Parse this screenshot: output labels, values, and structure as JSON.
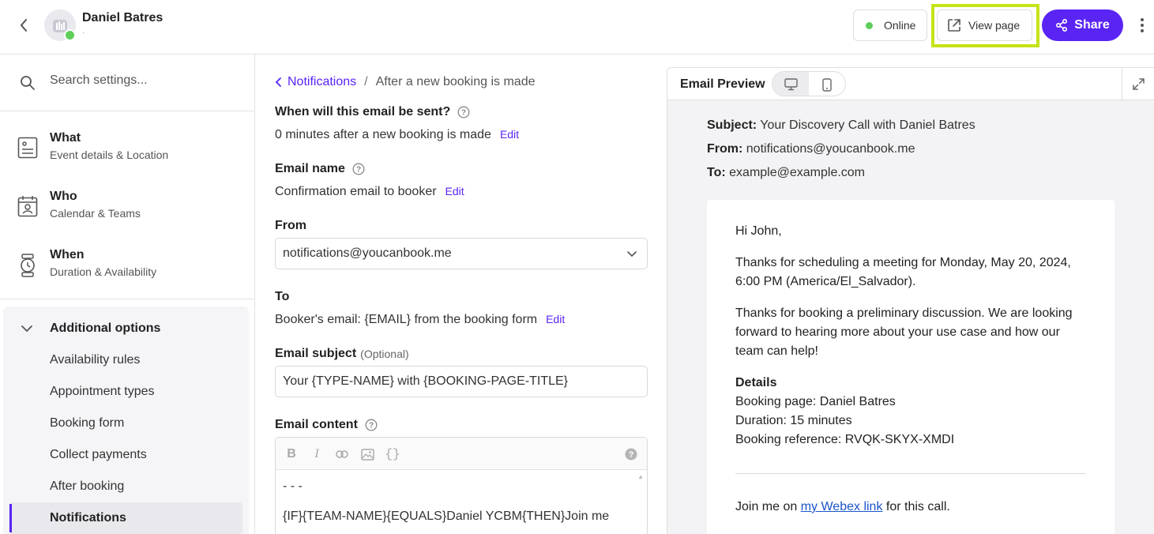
{
  "header": {
    "owner_name": "Daniel Batres",
    "owner_sub": "·",
    "online_label": "Online",
    "view_page_label": "View page",
    "share_label": "Share",
    "accent_color": "#5a24f5",
    "online_color": "#5fce5b",
    "highlight_color": "#c6e317"
  },
  "sidebar": {
    "search_placeholder": "Search settings...",
    "items": [
      {
        "title": "What",
        "subtitle": "Event details & Location",
        "icon": "form-icon"
      },
      {
        "title": "Who",
        "subtitle": "Calendar & Teams",
        "icon": "calendar-user-icon"
      },
      {
        "title": "When",
        "subtitle": "Duration & Availability",
        "icon": "watch-icon"
      }
    ],
    "additional": {
      "title": "Additional options",
      "items": [
        "Availability rules",
        "Appointment types",
        "Booking form",
        "Collect payments",
        "After booking",
        "Notifications"
      ],
      "active": "Notifications"
    }
  },
  "editor": {
    "breadcrumb": {
      "parent": "Notifications",
      "separator": "/",
      "current": "After a new booking is made"
    },
    "when_label": "When will this email be sent?",
    "when_value": "0 minutes after a new booking is made",
    "email_name_label": "Email name",
    "email_name_value": "Confirmation email to booker",
    "from_label": "From",
    "from_value": "notifications@youcanbook.me",
    "to_label": "To",
    "to_value": "Booker's email: {EMAIL} from the booking form",
    "edit_label": "Edit",
    "subject_label": "Email subject",
    "subject_optional": "(Optional)",
    "subject_value": "Your {TYPE-NAME} with {BOOKING-PAGE-TITLE}",
    "content_label": "Email content",
    "toolbar": {
      "bold": "B",
      "italic": "I",
      "variables": "{}"
    },
    "content_lines": [
      "- - -",
      "{IF}{TEAM-NAME}{EQUALS}Daniel YCBM{THEN}Join me"
    ]
  },
  "preview": {
    "title": "Email Preview",
    "subject_label": "Subject:",
    "subject_value": "Your Discovery Call with Daniel Batres",
    "from_label": "From:",
    "from_value": "notifications@youcanbook.me",
    "to_label": "To:",
    "to_value": "example@example.com",
    "greeting": "Hi John,",
    "para1": "Thanks for scheduling a meeting for Monday, May 20, 2024, 6:00 PM (America/El_Salvador).",
    "para2": "Thanks for booking a preliminary discussion. We are looking forward to hearing more about your use case and how our team can help!",
    "details_title": "Details",
    "details_lines": [
      "Booking page: Daniel Batres",
      "Duration: 15 minutes",
      "Booking reference: RVQK-SKYX-XMDI"
    ],
    "join_prefix": "Join me on ",
    "join_link": "my Webex link",
    "join_suffix": " for this call."
  }
}
